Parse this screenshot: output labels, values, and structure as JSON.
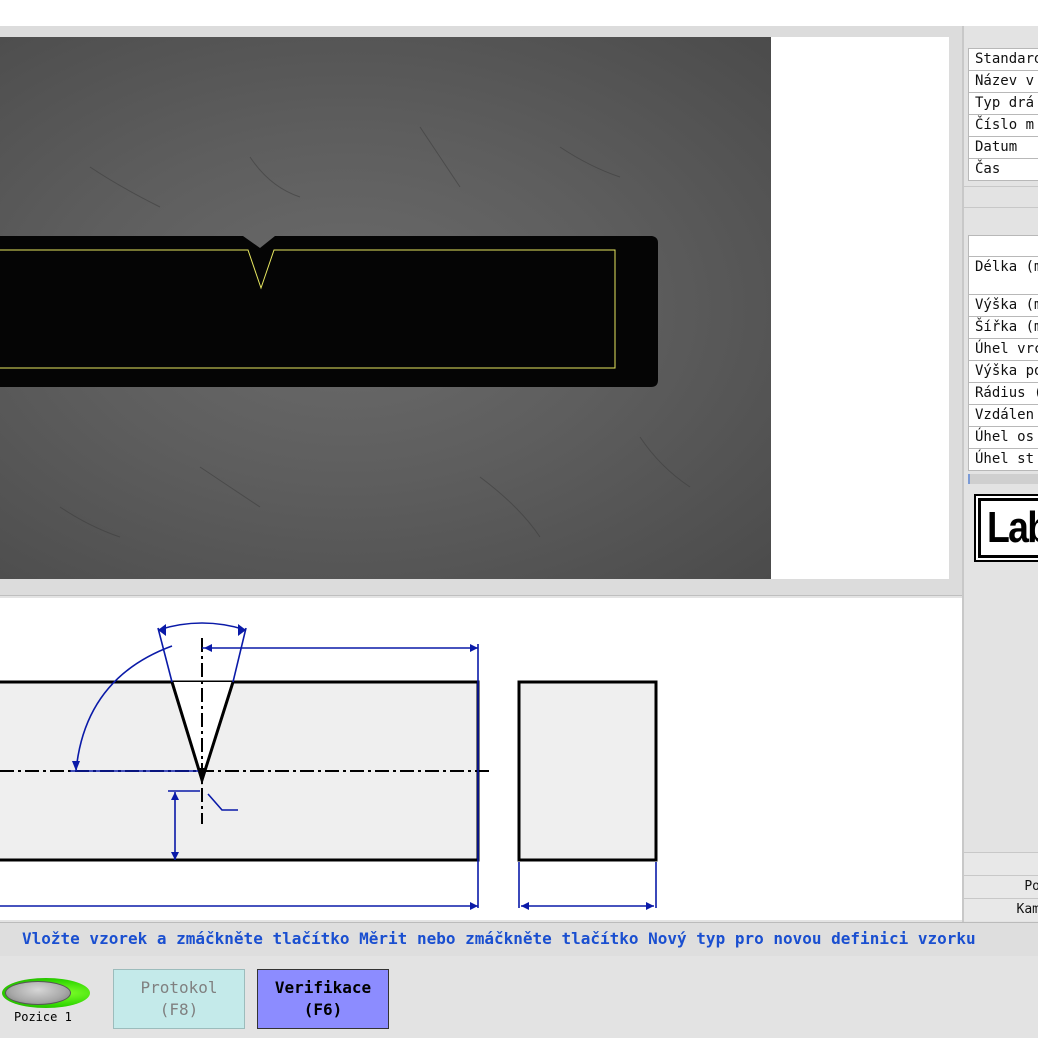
{
  "info_rows": [
    "Standard",
    "Název v",
    "Typ drá",
    "Číslo m",
    "Datum",
    "Čas"
  ],
  "param_rows": {
    "length": "Délka (m",
    "rows": [
      "Výška (m",
      "Šířka (m",
      "Úhel vrc",
      "Výška po",
      "Rádius (",
      "Vzdálen",
      "Úhel os",
      "Úhel st"
    ]
  },
  "logo_text": "Lab",
  "status": {
    "position_short": "Po",
    "camera_short": "Kam"
  },
  "message": "Vložte vzorek a zmáčkněte tlačítko Měrit nebo zmáčkněte tlačítko Nový typ pro novou definici vzorku",
  "indicator": {
    "label": "Pozice 1"
  },
  "buttons": {
    "protokol": {
      "line1": "Protokol",
      "line2": "(F8)"
    },
    "verifikace": {
      "line1": "Verifikace",
      "line2": "(F6)"
    }
  },
  "colors": {
    "message_text": "#1a4fd0",
    "verif_button": "#8c8cff",
    "protokol_button": "#c4eaea",
    "drawing_line": "#0a1aa8",
    "contour": "#e8e860"
  }
}
